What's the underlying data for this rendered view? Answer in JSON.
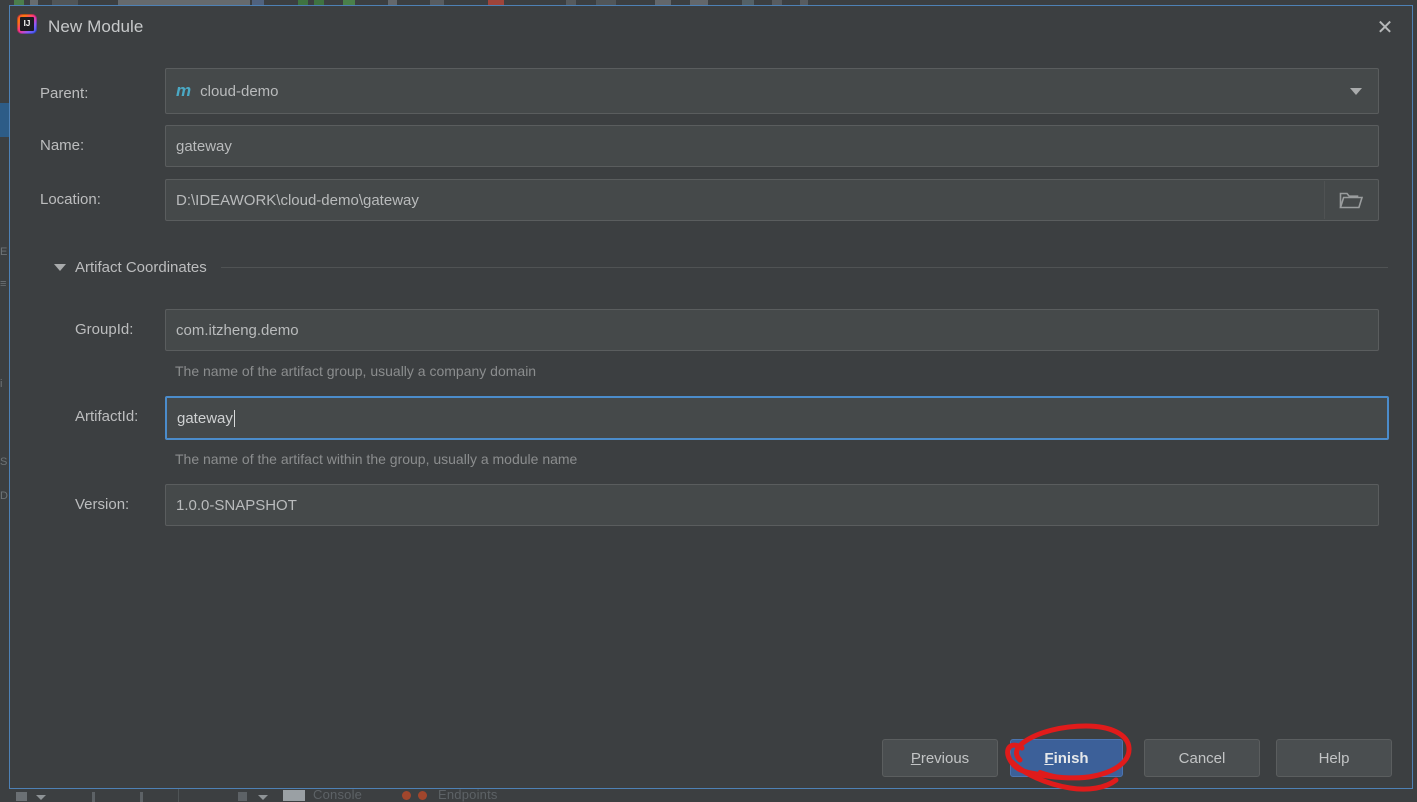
{
  "dialog": {
    "title": "New Module",
    "icon": "intellij-idea-icon",
    "close_icon": "close-icon",
    "accent_border": "#4e81b5"
  },
  "form": {
    "parent": {
      "label": "Parent:",
      "value": "cloud-demo",
      "icon": "maven-module-icon",
      "icon_glyph": "m",
      "dropdown_icon": "chevron-down-icon"
    },
    "name": {
      "label": "Name:",
      "value": "gateway"
    },
    "location": {
      "label": "Location:",
      "value": "D:\\IDEAWORK\\cloud-demo\\gateway",
      "browse_icon": "folder-open-icon"
    }
  },
  "artifact_section": {
    "title": "Artifact Coordinates",
    "expander_icon": "triangle-down-icon",
    "group_id": {
      "label": "GroupId:",
      "value": "com.itzheng.demo",
      "hint": "The name of the artifact group, usually a company domain"
    },
    "artifact_id": {
      "label": "ArtifactId:",
      "value": "gateway",
      "hint": "The name of the artifact within the group, usually a module name",
      "focused": true
    },
    "version": {
      "label": "Version:",
      "value": "1.0.0-SNAPSHOT"
    }
  },
  "buttons": {
    "previous": {
      "label": "Previous",
      "mnemonic": "P",
      "rest": "revious"
    },
    "finish": {
      "label": "Finish",
      "mnemonic": "F",
      "rest": "inish",
      "primary": true,
      "color": "#3c6099"
    },
    "cancel": {
      "label": "Cancel"
    },
    "help": {
      "label": "Help"
    }
  },
  "annotation": {
    "shape": "hand-drawn-red-circle",
    "color": "#e01b1b",
    "target": "finish-button"
  },
  "backdrop": {
    "tabs": [
      {
        "label": "Console",
        "icon": "console-icon"
      },
      {
        "label": "Endpoints",
        "icon": "endpoints-icon"
      }
    ]
  }
}
